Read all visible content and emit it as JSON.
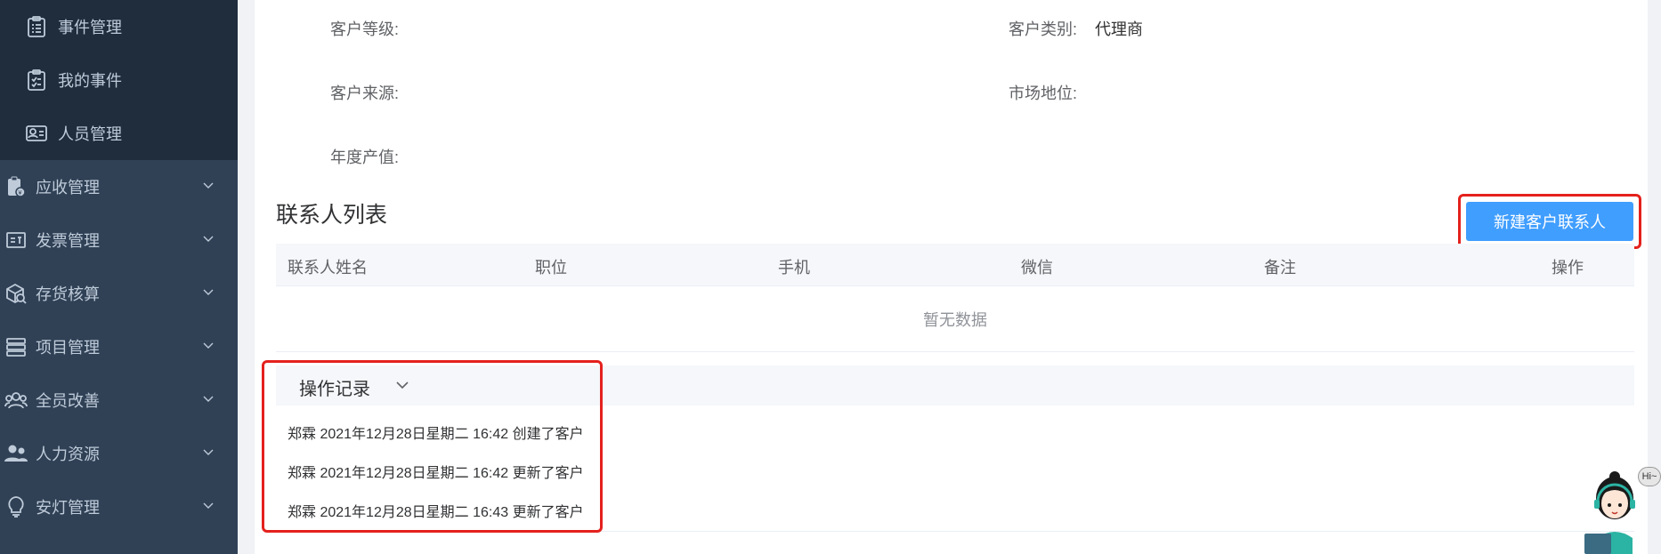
{
  "sidebar": {
    "sub_items": [
      {
        "label": "事件管理",
        "icon": "clipboard-list-icon"
      },
      {
        "label": "我的事件",
        "icon": "clipboard-check-icon"
      },
      {
        "label": "人员管理",
        "icon": "id-card-icon"
      }
    ],
    "menu_items": [
      {
        "label": "应收管理",
        "icon": "receivable-icon"
      },
      {
        "label": "发票管理",
        "icon": "invoice-icon"
      },
      {
        "label": "存货核算",
        "icon": "inventory-icon"
      },
      {
        "label": "项目管理",
        "icon": "project-icon"
      },
      {
        "label": "全员改善",
        "icon": "users-icon"
      },
      {
        "label": "人力资源",
        "icon": "people-icon"
      },
      {
        "label": "安灯管理",
        "icon": "lightbulb-icon"
      }
    ]
  },
  "customer": {
    "level_label": "客户等级:",
    "level_value": "",
    "category_label": "客户类别:",
    "category_value": "代理商",
    "source_label": "客户来源:",
    "source_value": "",
    "market_label": "市场地位:",
    "market_value": "",
    "output_label": "年度产值:",
    "output_value": ""
  },
  "contacts": {
    "title": "联系人列表",
    "new_button": "新建客户联系人",
    "columns": [
      "联系人姓名",
      "职位",
      "手机",
      "微信",
      "备注",
      "操作"
    ],
    "empty_text": "暂无数据"
  },
  "log": {
    "title": "操作记录",
    "items": [
      "郑霖 2021年12月28日星期二 16:42 创建了客户",
      "郑霖 2021年12月28日星期二 16:42 更新了客户",
      "郑霖 2021年12月28日星期二 16:43 更新了客户"
    ]
  },
  "assistant": {
    "badge": "Hi~"
  },
  "colors": {
    "sidebar_bg": "#304156",
    "submenu_bg": "#1f2d3d",
    "primary": "#409eff",
    "highlight_border": "#e4211d"
  }
}
